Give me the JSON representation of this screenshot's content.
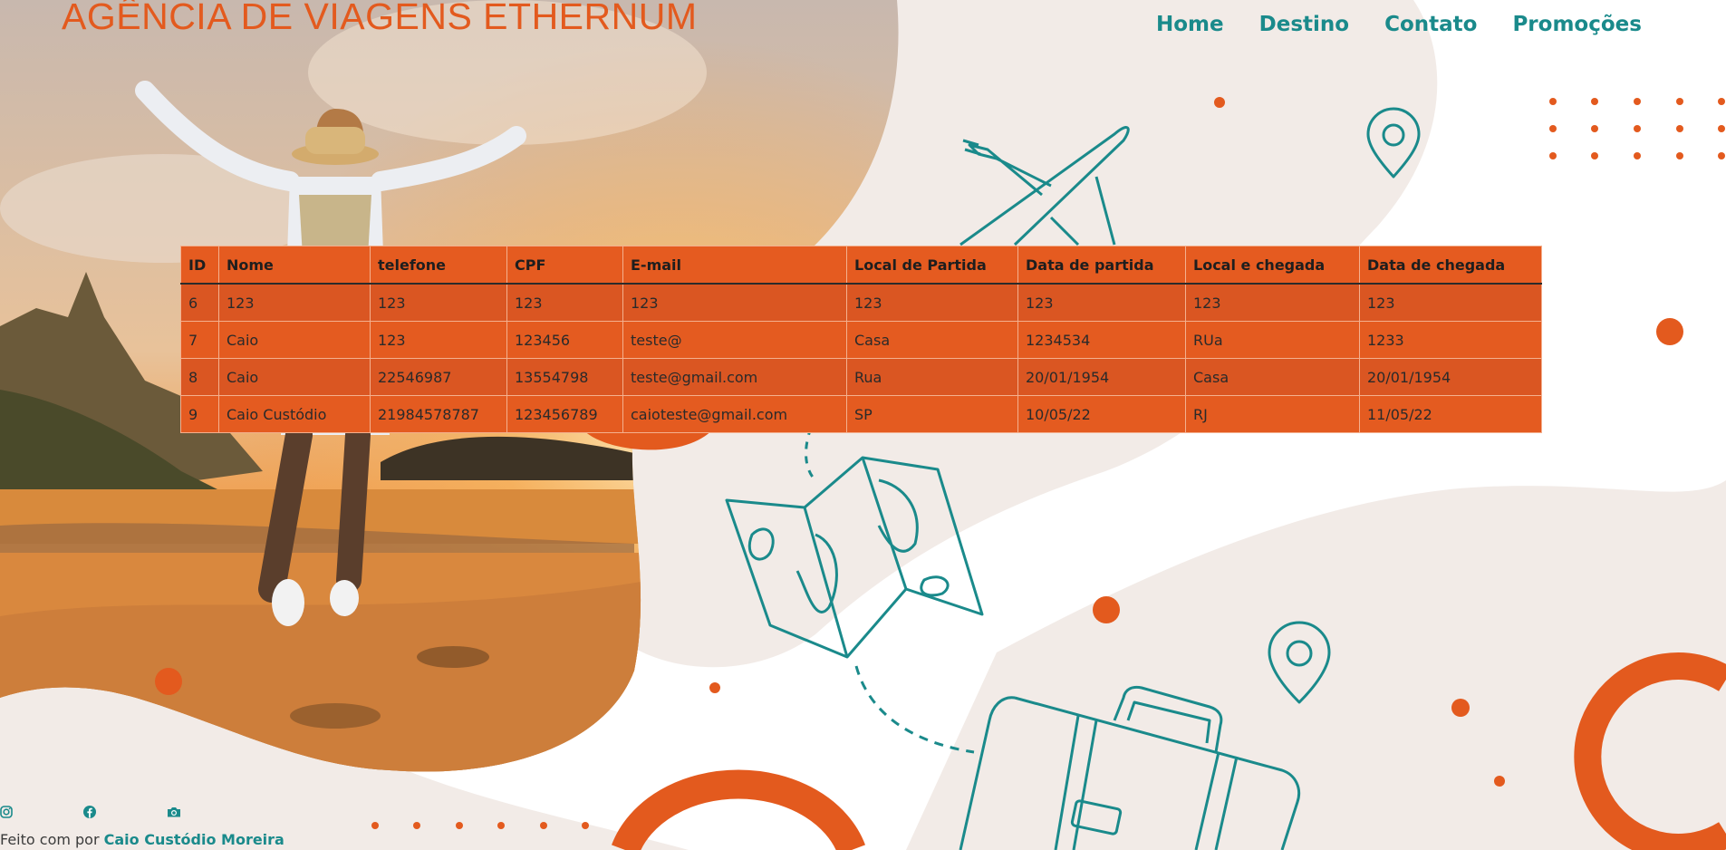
{
  "header": {
    "brand": "AGÊNCIA DE VIAGENS ETHERNUM"
  },
  "nav": [
    {
      "label": "Home"
    },
    {
      "label": "Destino"
    },
    {
      "label": "Contato"
    },
    {
      "label": "Promoções"
    }
  ],
  "table": {
    "columns": [
      "ID",
      "Nome",
      "telefone",
      "CPF",
      "E-mail",
      "Local de Partida",
      "Data de partida",
      "Local e chegada",
      "Data de chegada"
    ],
    "rows": [
      [
        "6",
        "123",
        "123",
        "123",
        "123",
        "123",
        "123",
        "123",
        "123"
      ],
      [
        "7",
        "Caio",
        "123",
        "123456",
        "teste@",
        "Casa",
        "1234534",
        "RUa",
        "1233"
      ],
      [
        "8",
        "Caio",
        "22546987",
        "13554798",
        "teste@gmail.com",
        "Rua",
        "20/01/1954",
        "Casa",
        "20/01/1954"
      ],
      [
        "9",
        "Caio Custódio",
        "21984578787",
        "123456789",
        "caioteste@gmail.com",
        "SP",
        "10/05/22",
        "RJ",
        "11/05/22"
      ]
    ]
  },
  "social": [
    {
      "icon": "instagram-icon"
    },
    {
      "icon": "facebook-icon"
    },
    {
      "icon": "camera-icon"
    }
  ],
  "footer": {
    "prefix": "Feito com por",
    "author": "Caio Custódio Moreira"
  },
  "colors": {
    "accent": "#e35a1e",
    "teal": "#1a8a8b",
    "blob": "#f2ebe7"
  }
}
